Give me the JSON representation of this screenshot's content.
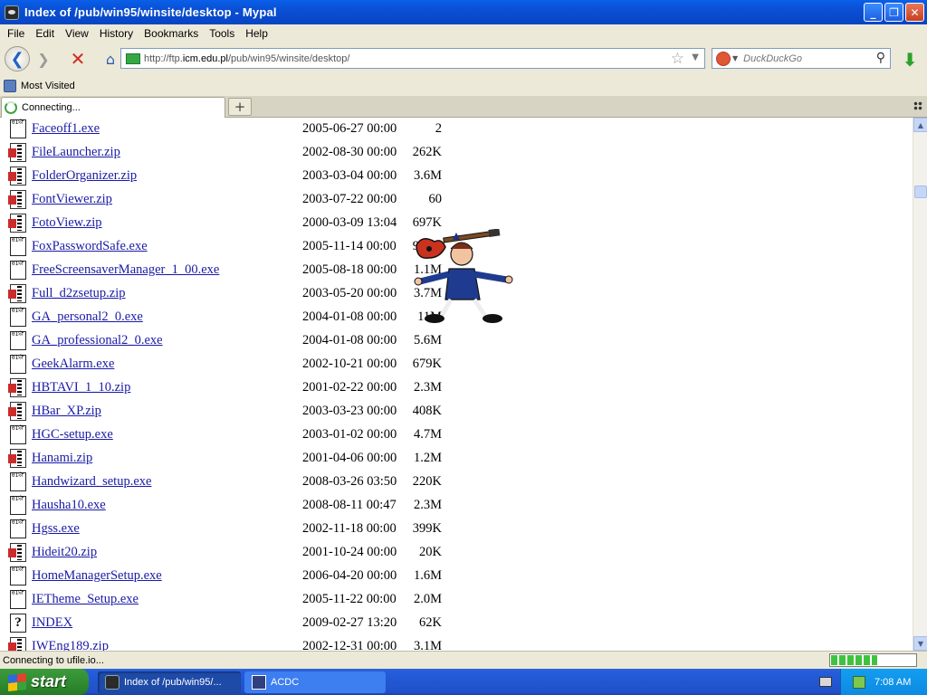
{
  "window": {
    "title": "Index of /pub/win95/winsite/desktop - Mypal",
    "min": "_",
    "max": "❐",
    "close": "✕"
  },
  "menu": [
    "File",
    "Edit",
    "View",
    "History",
    "Bookmarks",
    "Tools",
    "Help"
  ],
  "nav": {
    "back": "❮",
    "forward": "❯",
    "stop": "✕",
    "home": "⌂",
    "url_prefix": "http://ftp.",
    "url_host": "icm.edu.pl",
    "url_path": "/pub/win95/winsite/desktop/",
    "star": "☆",
    "dropdown": "▼",
    "search_placeholder": "DuckDuckGo",
    "search_icon": "⚲",
    "download": "⬇"
  },
  "bookmarks": {
    "most_visited": "Most Visited"
  },
  "tab": {
    "title": "Connecting...",
    "new_tab": "+"
  },
  "listing": [
    {
      "type": "exe",
      "name": "Faceoff1.exe",
      "date": "2005-06-27 00:00",
      "size": "2"
    },
    {
      "type": "zip",
      "name": "FileLauncher.zip",
      "date": "2002-08-30 00:00",
      "size": "262K"
    },
    {
      "type": "zip",
      "name": "FolderOrganizer.zip",
      "date": "2003-03-04 00:00",
      "size": "3.6M"
    },
    {
      "type": "zip",
      "name": "FontViewer.zip",
      "date": "2003-07-22 00:00",
      "size": "60"
    },
    {
      "type": "zip",
      "name": "FotoView.zip",
      "date": "2000-03-09 13:04",
      "size": "697K"
    },
    {
      "type": "exe",
      "name": "FoxPasswordSafe.exe",
      "date": "2005-11-14 00:00",
      "size": "928K"
    },
    {
      "type": "exe",
      "name": "FreeScreensaverManager_1_00.exe",
      "date": "2005-08-18 00:00",
      "size": "1.1M"
    },
    {
      "type": "zip",
      "name": "Full_d2zsetup.zip",
      "date": "2003-05-20 00:00",
      "size": "3.7M"
    },
    {
      "type": "exe",
      "name": "GA_personal2_0.exe",
      "date": "2004-01-08 00:00",
      "size": "11M"
    },
    {
      "type": "exe",
      "name": "GA_professional2_0.exe",
      "date": "2004-01-08 00:00",
      "size": "5.6M"
    },
    {
      "type": "exe",
      "name": "GeekAlarm.exe",
      "date": "2002-10-21 00:00",
      "size": "679K"
    },
    {
      "type": "zip",
      "name": "HBTAVI_1_10.zip",
      "date": "2001-02-22 00:00",
      "size": "2.3M"
    },
    {
      "type": "zip",
      "name": "HBar_XP.zip",
      "date": "2003-03-23 00:00",
      "size": "408K"
    },
    {
      "type": "exe",
      "name": "HGC-setup.exe",
      "date": "2003-01-02 00:00",
      "size": "4.7M"
    },
    {
      "type": "zip",
      "name": "Hanami.zip",
      "date": "2001-04-06 00:00",
      "size": "1.2M"
    },
    {
      "type": "exe",
      "name": "Handwizard_setup.exe",
      "date": "2008-03-26 03:50",
      "size": "220K"
    },
    {
      "type": "exe",
      "name": "Hausha10.exe",
      "date": "2008-08-11 00:47",
      "size": "2.3M"
    },
    {
      "type": "exe",
      "name": "Hgss.exe",
      "date": "2002-11-18 00:00",
      "size": "399K"
    },
    {
      "type": "zip",
      "name": "Hideit20.zip",
      "date": "2001-10-24 00:00",
      "size": "20K"
    },
    {
      "type": "exe",
      "name": "HomeManagerSetup.exe",
      "date": "2006-04-20 00:00",
      "size": "1.6M"
    },
    {
      "type": "exe",
      "name": "IETheme_Setup.exe",
      "date": "2005-11-22 00:00",
      "size": "2.0M"
    },
    {
      "type": "unknown",
      "name": "INDEX",
      "date": "2009-02-27 13:20",
      "size": "62K"
    },
    {
      "type": "zip",
      "name": "IWEng189.zip",
      "date": "2002-12-31 00:00",
      "size": "3.1M"
    }
  ],
  "status": {
    "text": "Connecting to ufile.io...",
    "progress": 0.55
  },
  "taskbar": {
    "start": "start",
    "items": [
      "Index of /pub/win95/...",
      "ACDC"
    ],
    "clock": "7:08 AM"
  }
}
